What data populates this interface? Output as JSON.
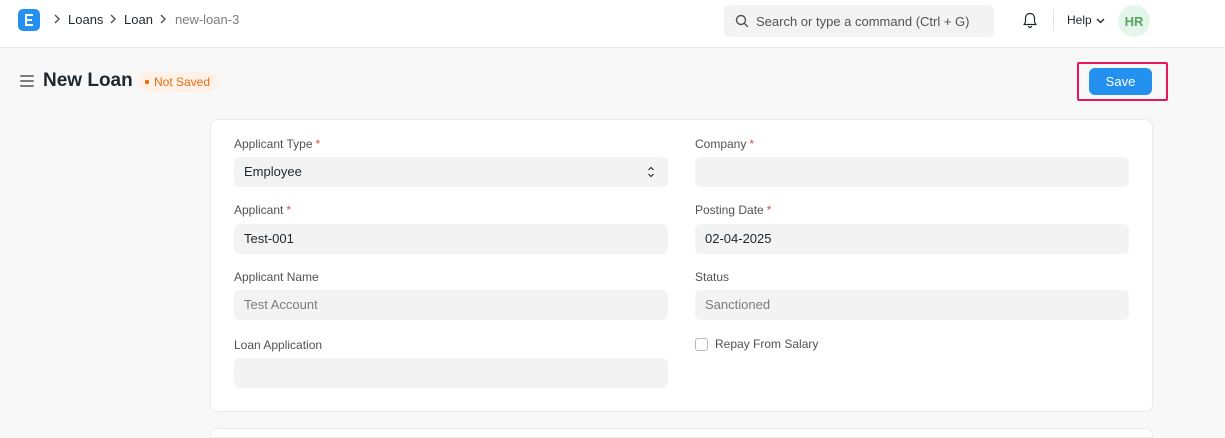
{
  "navbar": {
    "breadcrumbs": [
      "Loans",
      "Loan",
      "new-loan-3"
    ],
    "search_placeholder": "Search or type a command (Ctrl + G)",
    "help_label": "Help",
    "avatar_initials": "HR"
  },
  "page": {
    "title": "New Loan",
    "status": "Not Saved",
    "save_label": "Save"
  },
  "form": {
    "applicant_type": {
      "label": "Applicant Type",
      "value": "Employee"
    },
    "company": {
      "label": "Company",
      "value": ""
    },
    "applicant": {
      "label": "Applicant",
      "value": "Test-001"
    },
    "posting_date": {
      "label": "Posting Date",
      "value": "02-04-2025"
    },
    "applicant_name": {
      "label": "Applicant Name",
      "value": "Test Account"
    },
    "status": {
      "label": "Status",
      "value": "Sanctioned"
    },
    "loan_application": {
      "label": "Loan Application",
      "value": ""
    },
    "repay_from_salary": {
      "label": "Repay From Salary",
      "checked": false
    },
    "required_marker": "*"
  },
  "colors": {
    "accent": "#2490ef",
    "highlight": "#e8175d",
    "status_text": "#e86c13",
    "status_bg": "#fff1e7",
    "avatar_bg": "#e4f5e9",
    "avatar_text": "#5aa461"
  },
  "icons": [
    "app-logo-icon",
    "chevron-right-icon",
    "search-icon",
    "bell-icon",
    "chevron-down-icon",
    "hamburger-icon",
    "select-arrows-icon"
  ]
}
